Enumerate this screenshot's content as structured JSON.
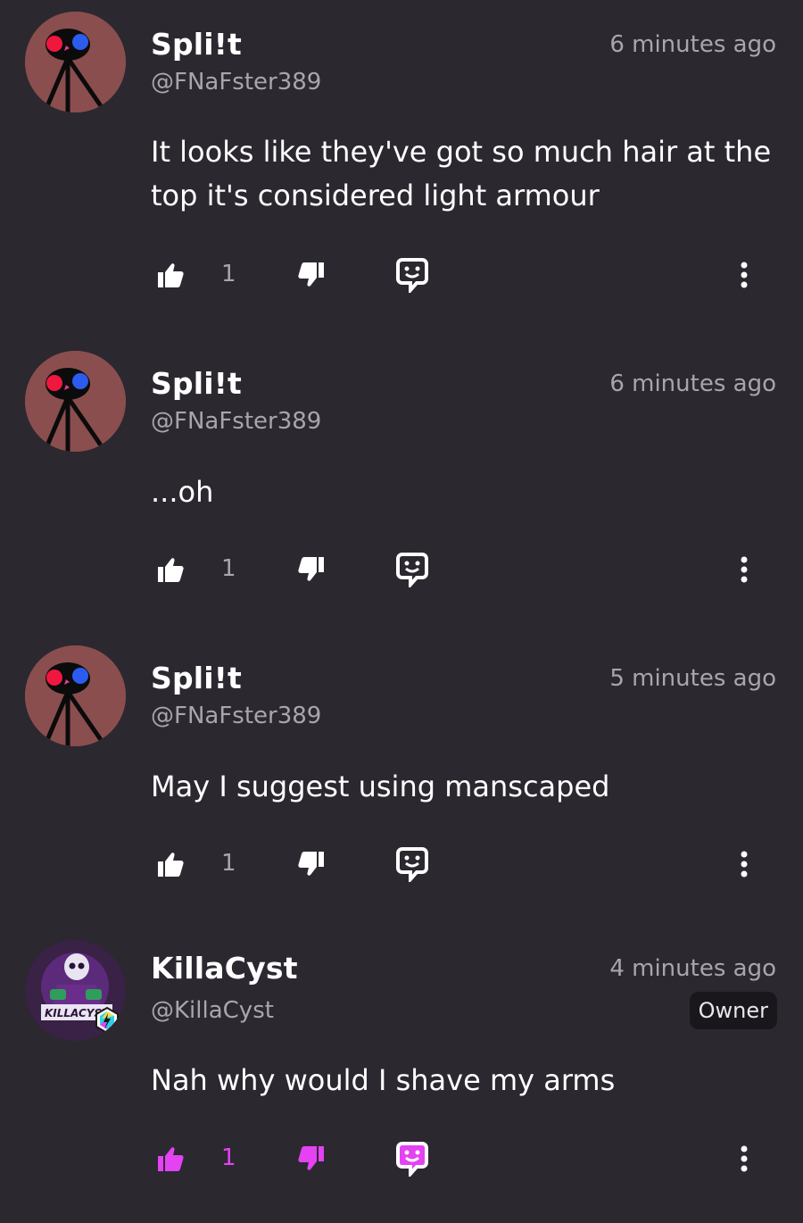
{
  "comments": [
    {
      "username": "Spli!t",
      "handle": "@FNaFster389",
      "time": "6 minutes ago",
      "text": "It looks like they've got so much hair at the top it's considered light armour",
      "likes": "1",
      "avatar": "stick-figure-avatar"
    },
    {
      "username": "Spli!t",
      "handle": "@FNaFster389",
      "time": "6 minutes ago",
      "text": "...oh",
      "likes": "1",
      "avatar": "stick-figure-avatar"
    },
    {
      "username": "Spli!t",
      "handle": "@FNaFster389",
      "time": "5 minutes ago",
      "text": "May I suggest using manscaped",
      "likes": "1",
      "avatar": "stick-figure-avatar"
    },
    {
      "username": "KillaCyst",
      "handle": "@KillaCyst",
      "time": "4 minutes ago",
      "badge": "Owner",
      "text": "Nah why would I shave my arms",
      "likes": "1",
      "liked": true,
      "avatar": "skull-logo-avatar",
      "avatar_text": "KILLACYST"
    }
  ],
  "colors": {
    "background": "#2b2830",
    "liked_accent": "#e442f2",
    "muted_text": "#a8a5ac"
  },
  "icons": [
    "thumbs-up-icon",
    "thumbs-down-icon",
    "reply-icon",
    "more-icon"
  ]
}
